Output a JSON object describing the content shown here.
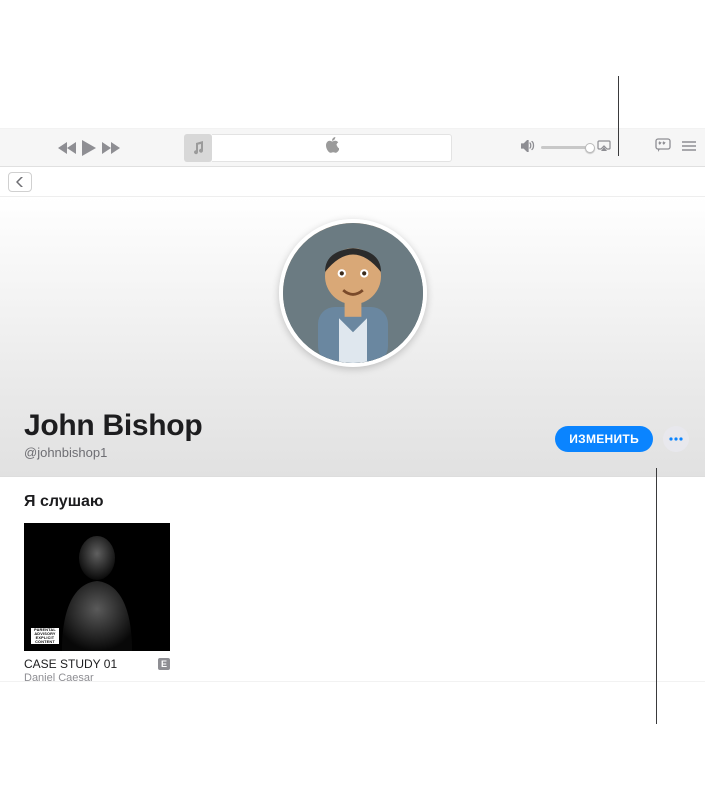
{
  "profile": {
    "name": "John Bishop",
    "handle": "@johnbishop1"
  },
  "actions": {
    "edit_label": "ИЗМЕНИТЬ"
  },
  "section": {
    "listening_title": "Я слушаю"
  },
  "album": {
    "title": "CASE STUDY 01",
    "artist": "Daniel Caesar",
    "advisory": "PARENTAL ADVISORY EXPLICIT CONTENT",
    "explicit_badge": "E"
  }
}
